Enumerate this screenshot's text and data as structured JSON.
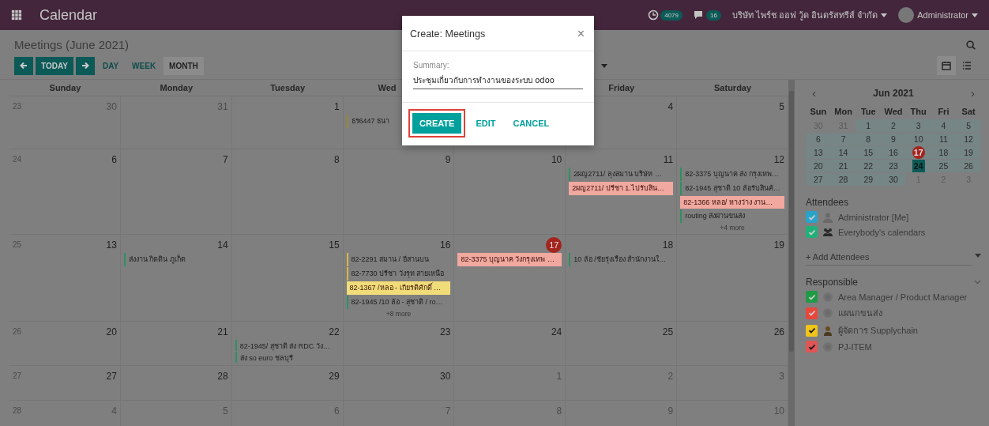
{
  "navbar": {
    "app_title": "Calendar",
    "activity_badge": "4079",
    "chat_badge": "16",
    "company": "บริษัท ไพร์ช ออฟ วู้ด อินดรัสทรีส์ จำกัด",
    "user": "Administrator"
  },
  "control_panel": {
    "title": "Meetings (June 2021)",
    "today_button": "TODAY",
    "scales": [
      {
        "label": "DAY",
        "selected": false
      },
      {
        "label": "WEEK",
        "selected": false
      },
      {
        "label": "MONTH",
        "selected": true
      }
    ],
    "views": [
      {
        "kind": "calendar",
        "selected": true
      },
      {
        "kind": "list",
        "selected": false
      }
    ]
  },
  "calendar": {
    "headers": [
      "Sunday",
      "Monday",
      "Tuesday",
      "Wed",
      "Friday",
      "Saturday"
    ],
    "weeks": [
      {
        "week": "23",
        "days": [
          {
            "day": "30",
            "muted": true
          },
          {
            "day": "31",
            "muted": true
          },
          {
            "day": "1",
            "muted": false
          },
          {
            "events": [
              {
                "text": "ธร6447 ธนา",
                "kind": "bar",
                "color": "#9a8636"
              }
            ]
          },
          {
            "day": "4",
            "muted": false
          },
          {
            "day": "5",
            "muted": false
          }
        ]
      },
      {
        "week": "24",
        "days": [
          {
            "day": "6",
            "muted": false
          },
          {
            "day": "7",
            "muted": false
          },
          {
            "day": "8",
            "muted": false
          },
          {
            "day": "9",
            "muted": false
          },
          {
            "day": "10",
            "muted": false
          },
          {
            "day": "11",
            "muted": false,
            "events": [
              {
                "text": "2ผญ2711/ ลุงสมาน บริษัท …",
                "kind": "bar",
                "color": "#2f8f63"
              },
              {
                "text": "2ผญ2711/ ปรีชา 1.ไปรับสิน…",
                "kind": "filled",
                "color": "#f0a89f"
              }
            ]
          },
          {
            "day": "12",
            "muted": false,
            "events": [
              {
                "text": "82-3375 บุญนาค ส่ง กรุงเทพ…",
                "kind": "bar",
                "color": "#2f8f63"
              },
              {
                "text": "82-1945 สุชาติ 10 ล้อรับสินค้…",
                "kind": "bar",
                "color": "#2f8f63"
              },
              {
                "text": "82-1366 หลอ/ หางว่าง งาน…",
                "kind": "filled",
                "color": "#f0a89f"
              },
              {
                "text": "routing ส่งผ่านขนส่ง",
                "kind": "bar",
                "color": "#2f8f63"
              }
            ],
            "more": "+4 more"
          }
        ]
      },
      {
        "week": "25",
        "days": [
          {
            "day": "13",
            "muted": false
          },
          {
            "day": "14",
            "muted": false,
            "events": [
              {
                "text": "ส่งงาน กิตติน ภูเก็ต",
                "kind": "bar",
                "color": "#2f8f63"
              }
            ]
          },
          {
            "day": "15",
            "muted": false
          },
          {
            "day": "16",
            "muted": false,
            "events": [
              {
                "text": "82-2291 สมาน / อีสานบน",
                "kind": "bar",
                "color": "#d4b94a"
              },
              {
                "text": "82-7730 ปรีชา วังรุท สายเหนือ",
                "kind": "bar",
                "color": "#d4b94a"
              },
              {
                "text": "82-1367 /หลอ - เกียรติศักดิ์ …",
                "kind": "filled",
                "color": "#f0dc78"
              },
              {
                "text": "82-1945 /10 ล้อ - สุชาติ / ro…",
                "kind": "bar",
                "color": "#2f8f63"
              }
            ],
            "more": "+8 more"
          },
          {
            "day": "17",
            "muted": false,
            "today": true,
            "events": [
              {
                "text": "82-3375 บุญนาค วังกรุงเทพ …",
                "kind": "filled",
                "color": "#f0a89f"
              }
            ]
          },
          {
            "day": "18",
            "muted": false,
            "events": [
              {
                "text": "10 ล้อ /ชัยรุ่งเรือง สำนักงานใ…",
                "kind": "bar",
                "color": "#2f8f63"
              }
            ]
          },
          {
            "day": "19",
            "muted": false
          }
        ]
      },
      {
        "week": "26",
        "days": [
          {
            "day": "20",
            "muted": false
          },
          {
            "day": "21",
            "muted": false
          },
          {
            "day": "22",
            "muted": false,
            "events": [
              {
                "text": "82-1945/ สุชาติ ส่ง RDC วัง…",
                "kind": "bar",
                "color": "#2f8f63"
              },
              {
                "text": "ส่ง so euro ชลบุรี",
                "kind": "bar",
                "color": "#2f8f63"
              }
            ]
          },
          {
            "day": "23",
            "muted": false
          },
          {
            "day": "24",
            "muted": false
          },
          {
            "day": "25",
            "muted": false
          },
          {
            "day": "26",
            "muted": false
          }
        ]
      },
      {
        "week": "27",
        "days": [
          {
            "day": "27",
            "muted": false
          },
          {
            "day": "28",
            "muted": false
          },
          {
            "day": "29",
            "muted": false
          },
          {
            "day": "30",
            "muted": false
          },
          {
            "day": "1",
            "muted": true
          },
          {
            "day": "2",
            "muted": true
          },
          {
            "day": "3",
            "muted": true
          }
        ]
      },
      {
        "week": "28",
        "days": [
          {
            "day": "4",
            "muted": true
          },
          {
            "day": "5",
            "muted": true
          },
          {
            "day": "6",
            "muted": true
          },
          {
            "day": "7",
            "muted": true
          },
          {
            "day": "8",
            "muted": true
          },
          {
            "day": "9",
            "muted": true
          },
          {
            "day": "10",
            "muted": true
          }
        ]
      }
    ]
  },
  "sidebar": {
    "mini_calendar": {
      "month": "Jun 2021",
      "prev": "‹",
      "next": "›",
      "weekdays": [
        "Sun",
        "Mon",
        "Tue",
        "Wed",
        "Thu",
        "Fri",
        "Sat"
      ],
      "days": [
        {
          "day": "30",
          "muted": true
        },
        {
          "day": "31",
          "muted": true
        },
        {
          "day": "1",
          "muted": false
        },
        {
          "day": "2",
          "muted": false
        },
        {
          "day": "3",
          "muted": false
        },
        {
          "day": "4",
          "muted": false
        },
        {
          "day": "5",
          "muted": false
        },
        {
          "day": "6",
          "muted": false
        },
        {
          "day": "7",
          "muted": false
        },
        {
          "day": "8",
          "muted": false
        },
        {
          "day": "9",
          "muted": false
        },
        {
          "day": "10",
          "muted": false
        },
        {
          "day": "11",
          "muted": false
        },
        {
          "day": "12",
          "muted": false
        },
        {
          "day": "13",
          "muted": false
        },
        {
          "day": "14",
          "muted": false
        },
        {
          "day": "15",
          "muted": false
        },
        {
          "day": "16",
          "muted": false
        },
        {
          "day": "17",
          "muted": false,
          "today": true
        },
        {
          "day": "18",
          "muted": false
        },
        {
          "day": "19",
          "muted": false
        },
        {
          "day": "20",
          "muted": false
        },
        {
          "day": "21",
          "muted": false
        },
        {
          "day": "22",
          "muted": false
        },
        {
          "day": "23",
          "muted": false
        },
        {
          "day": "24",
          "muted": false,
          "selected": true
        },
        {
          "day": "25",
          "muted": false
        },
        {
          "day": "26",
          "muted": false
        },
        {
          "day": "27",
          "muted": false
        },
        {
          "day": "28",
          "muted": false
        },
        {
          "day": "29",
          "muted": false
        },
        {
          "day": "30",
          "muted": false
        },
        {
          "day": "1",
          "muted": true
        },
        {
          "day": "2",
          "muted": true
        },
        {
          "day": "3",
          "muted": true
        }
      ]
    },
    "attendees": {
      "title": "Attendees",
      "items": [
        {
          "label": "Administrator [Me]",
          "checked": true,
          "color": "#2aa3c9",
          "kind": "person"
        },
        {
          "label": "Everybody's calendars",
          "checked": true,
          "color": "#22b07a",
          "kind": "group"
        }
      ],
      "add_placeholder": "+ Add Attendees"
    },
    "responsible": {
      "title": "Responsible",
      "items": [
        {
          "label": "Area Manager / Product Manager",
          "checked": true,
          "color": "#1f9a45",
          "kind": "camera"
        },
        {
          "label": "แผนกขนส่ง",
          "checked": true,
          "color": "#e8473c",
          "kind": "camera"
        },
        {
          "label": "ผู้จัดการ Supplychain",
          "checked": true,
          "color": "#f0c419",
          "kind": "photo"
        },
        {
          "label": "PJ-ITEM",
          "checked": true,
          "color": "#e05555",
          "kind": "camera"
        }
      ]
    }
  },
  "dialog": {
    "title": "Create: Meetings",
    "close": "×",
    "field_label": "Summary:",
    "value": "ประชุมเกี่ยวกับการทำงานของระบบ odoo",
    "buttons": [
      {
        "label": "CREATE",
        "kind": "primary",
        "highlighted": true
      },
      {
        "label": "EDIT",
        "kind": "link",
        "highlighted": false
      },
      {
        "label": "CANCEL",
        "kind": "link",
        "highlighted": false
      }
    ]
  }
}
